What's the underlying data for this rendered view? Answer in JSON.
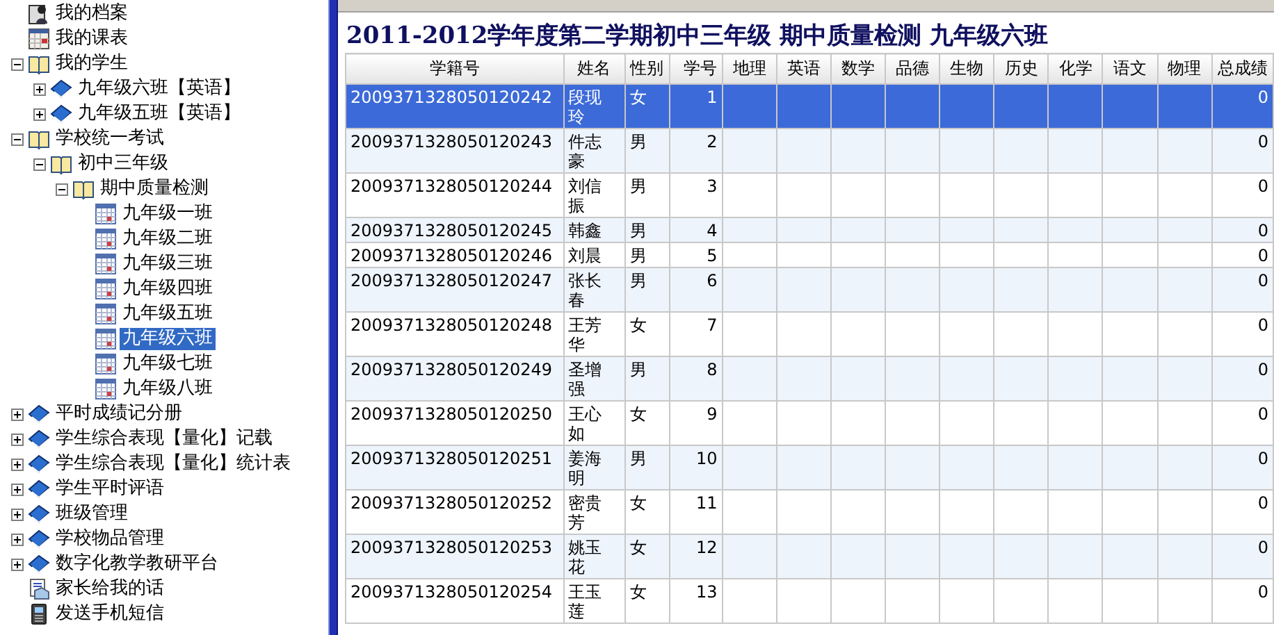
{
  "tree": [
    {
      "label": "我的档案",
      "kind": "profile",
      "selected": false
    },
    {
      "label": "我的课表",
      "kind": "calendar",
      "selected": false
    },
    {
      "label": "我的学生",
      "kind": "folder",
      "selected": false,
      "expanded": true,
      "children": [
        {
          "label": "九年级六班【英语】",
          "kind": "book",
          "selected": false,
          "expanded": false
        },
        {
          "label": "九年级五班【英语】",
          "kind": "book",
          "selected": false,
          "expanded": false
        }
      ]
    },
    {
      "label": "学校统一考试",
      "kind": "folder",
      "selected": false,
      "expanded": true,
      "children": [
        {
          "label": "初中三年级",
          "kind": "folder",
          "selected": false,
          "expanded": true,
          "children": [
            {
              "label": "期中质量检测",
              "kind": "folder",
              "selected": false,
              "expanded": true,
              "children": [
                {
                  "label": "九年级一班",
                  "kind": "sheet",
                  "selected": false
                },
                {
                  "label": "九年级二班",
                  "kind": "sheet",
                  "selected": false
                },
                {
                  "label": "九年级三班",
                  "kind": "sheet",
                  "selected": false
                },
                {
                  "label": "九年级四班",
                  "kind": "sheet",
                  "selected": false
                },
                {
                  "label": "九年级五班",
                  "kind": "sheet",
                  "selected": false
                },
                {
                  "label": "九年级六班",
                  "kind": "sheet",
                  "selected": true
                },
                {
                  "label": "九年级七班",
                  "kind": "sheet",
                  "selected": false
                },
                {
                  "label": "九年级八班",
                  "kind": "sheet",
                  "selected": false
                }
              ]
            }
          ]
        }
      ]
    },
    {
      "label": "平时成绩记分册",
      "kind": "book",
      "selected": false,
      "expanded": false
    },
    {
      "label": "学生综合表现【量化】记载",
      "kind": "book",
      "selected": false,
      "expanded": false
    },
    {
      "label": "学生综合表现【量化】统计表",
      "kind": "book",
      "selected": false,
      "expanded": false
    },
    {
      "label": "学生平时评语",
      "kind": "book",
      "selected": false,
      "expanded": false
    },
    {
      "label": "班级管理",
      "kind": "book",
      "selected": false,
      "expanded": false
    },
    {
      "label": "学校物品管理",
      "kind": "book",
      "selected": false,
      "expanded": false
    },
    {
      "label": "数字化教学教研平台",
      "kind": "book",
      "selected": false,
      "expanded": false
    },
    {
      "label": "家长给我的话",
      "kind": "letter",
      "selected": false
    },
    {
      "label": "发送手机短信",
      "kind": "phone",
      "selected": false
    }
  ],
  "report": {
    "title": "2011-2012学年度第二学期初中三年级 期中质量检测 九年级六班",
    "columns": [
      "学籍号",
      "姓名",
      "性别",
      "学号",
      "地理",
      "英语",
      "数学",
      "品德",
      "生物",
      "历史",
      "化学",
      "语文",
      "物理",
      "总成绩"
    ],
    "rows": [
      {
        "id": "2009371328050120242",
        "name": "段现玲",
        "gender": "女",
        "number": "1",
        "total": "0",
        "selected": true
      },
      {
        "id": "2009371328050120243",
        "name": "件志豪",
        "gender": "男",
        "number": "2",
        "total": "0",
        "selected": false
      },
      {
        "id": "2009371328050120244",
        "name": "刘信振",
        "gender": "男",
        "number": "3",
        "total": "0",
        "selected": false
      },
      {
        "id": "2009371328050120245",
        "name": "韩鑫",
        "gender": "男",
        "number": "4",
        "total": "0",
        "selected": false
      },
      {
        "id": "2009371328050120246",
        "name": "刘晨",
        "gender": "男",
        "number": "5",
        "total": "0",
        "selected": false
      },
      {
        "id": "2009371328050120247",
        "name": "张长春",
        "gender": "男",
        "number": "6",
        "total": "0",
        "selected": false
      },
      {
        "id": "2009371328050120248",
        "name": "王芳华",
        "gender": "女",
        "number": "7",
        "total": "0",
        "selected": false
      },
      {
        "id": "2009371328050120249",
        "name": "圣增强",
        "gender": "男",
        "number": "8",
        "total": "0",
        "selected": false
      },
      {
        "id": "2009371328050120250",
        "name": "王心如",
        "gender": "女",
        "number": "9",
        "total": "0",
        "selected": false
      },
      {
        "id": "2009371328050120251",
        "name": "姜海明",
        "gender": "男",
        "number": "10",
        "total": "0",
        "selected": false
      },
      {
        "id": "2009371328050120252",
        "name": "密贵芳",
        "gender": "女",
        "number": "11",
        "total": "0",
        "selected": false
      },
      {
        "id": "2009371328050120253",
        "name": "姚玉花",
        "gender": "女",
        "number": "12",
        "total": "0",
        "selected": false
      },
      {
        "id": "2009371328050120254",
        "name": "王玉莲",
        "gender": "女",
        "number": "13",
        "total": "0",
        "selected": false
      }
    ]
  }
}
